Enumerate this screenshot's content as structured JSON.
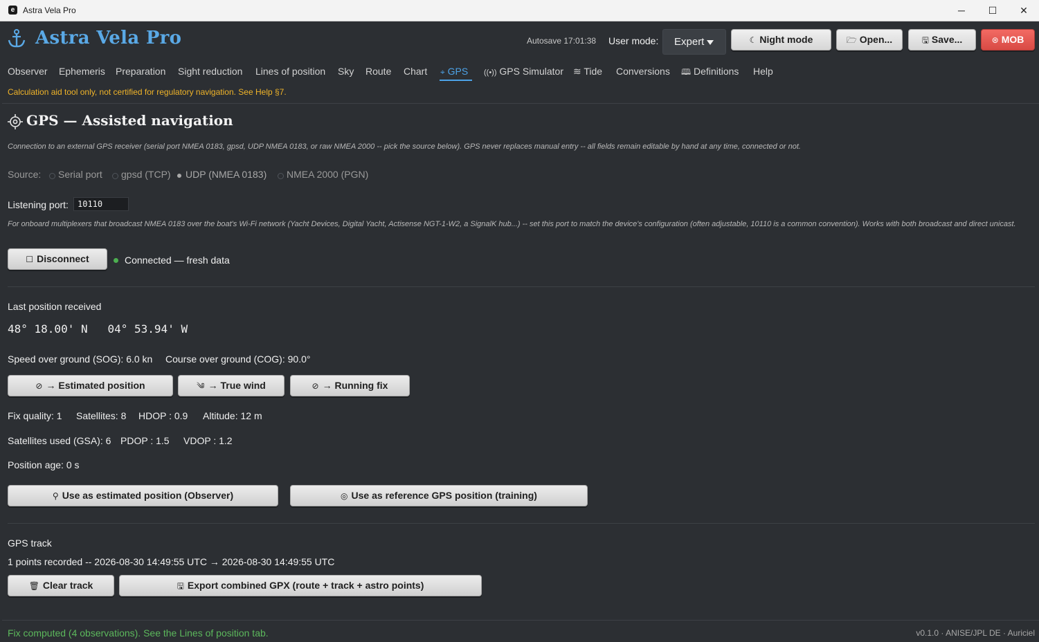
{
  "window": {
    "title": "Astra Vela Pro",
    "controls": {
      "minimize": "─",
      "maximize": "☐",
      "close": "✕"
    }
  },
  "header": {
    "app_name": "Astra Vela Pro",
    "autosave": "Autosave 17:01:38",
    "user_mode_label": "User mode:",
    "user_mode_value": "Expert",
    "buttons": {
      "night_mode": "Night mode",
      "open": "Open...",
      "save": "Save...",
      "mob": "MOB"
    }
  },
  "tabs": [
    {
      "label": "Observer"
    },
    {
      "label": "Ephemeris"
    },
    {
      "label": "Preparation"
    },
    {
      "label": "Sight reduction"
    },
    {
      "label": "Lines of position"
    },
    {
      "label": "Sky"
    },
    {
      "label": "Route"
    },
    {
      "label": "Chart"
    },
    {
      "label": "GPS",
      "icon": "crosshair-icon",
      "active": true
    },
    {
      "label": "GPS Simulator",
      "icon": "broadcast-icon"
    },
    {
      "label": "Tide",
      "icon": "waves-icon"
    },
    {
      "label": "Conversions"
    },
    {
      "label": "Definitions",
      "icon": "book-icon"
    },
    {
      "label": "Help"
    }
  ],
  "disclaimer": "Calculation aid tool only, not certified for regulatory navigation. See Help §7.",
  "section": {
    "title": "GPS — Assisted navigation",
    "description": "Connection to an external GPS receiver (serial port NMEA 0183, gpsd, UDP NMEA 0183, or raw NMEA 2000 -- pick the source below). GPS never replaces manual entry -- all fields remain editable by hand at any time, connected or not."
  },
  "source": {
    "label": "Source:",
    "options": [
      "Serial port",
      "gpsd (TCP)",
      "UDP (NMEA 0183)",
      "NMEA 2000 (PGN)"
    ],
    "selected": "UDP (NMEA 0183)"
  },
  "port": {
    "label": "Listening port:",
    "value": "10110",
    "help": "For onboard multiplexers that broadcast NMEA 0183 over the boat's Wi-Fi network (Yacht Devices, Digital Yacht, Actisense NGT-1-W2, a SignalK hub...) -- set this port to match the device's configuration (often adjustable, 10110 is a common convention). Works with both broadcast and direct unicast."
  },
  "connection": {
    "disconnect_label": "Disconnect",
    "status": "Connected — fresh data",
    "status_color": "#4caf50"
  },
  "position": {
    "heading": "Last position received",
    "coords": "48° 18.00' N   04° 53.94' W",
    "sog": "Speed over ground (SOG): 6.0 kn",
    "cog": "Course over ground (COG): 90.0°"
  },
  "actions": {
    "estimated_position": "→ Estimated position",
    "true_wind": "→ True wind",
    "running_fix": "→ Running fix"
  },
  "metrics": {
    "fix_quality": "Fix quality: 1",
    "satellites": "Satellites: 8",
    "hdop": "HDOP : 0.9",
    "altitude": "Altitude: 12 m",
    "sats_used": "Satellites used (GSA): 6",
    "pdop": "PDOP : 1.5",
    "vdop": "VDOP : 1.2",
    "age": "Position age: 0 s"
  },
  "use_buttons": {
    "estimated": "Use as estimated position (Observer)",
    "reference": "Use as reference GPS position (training)"
  },
  "track": {
    "heading": "GPS track",
    "summary": "1 points recorded -- 2026-08-30 14:49:55 UTC → 2026-08-30 14:49:55 UTC",
    "clear_label": "Clear track",
    "export_label": "Export combined GPX (route + track + astro points)"
  },
  "footer": {
    "status": "Fix computed (4 observations). See the Lines of position tab.",
    "version": "v0.1.0 · ANISE/JPL DE · Auriciel"
  },
  "colors": {
    "accent": "#4da3e8",
    "warning": "#f0b429",
    "success": "#5cb85c",
    "danger": "#d84a44",
    "background": "#2c2f33"
  }
}
